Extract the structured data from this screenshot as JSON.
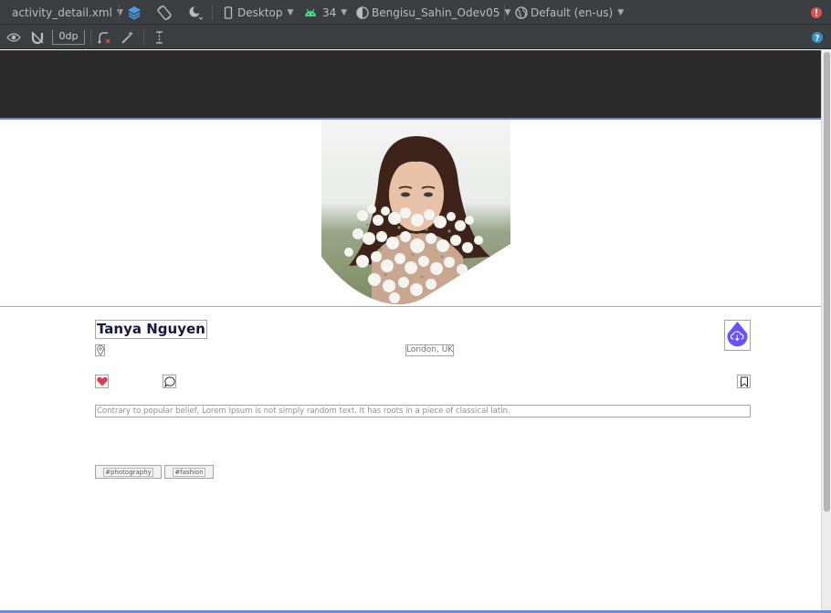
{
  "toolbar": {
    "file_name": "activity_detail.xml",
    "device": "Desktop",
    "api_level": "34",
    "theme": "Bengisu_Sahin_Odev05",
    "locale": "Default (en-us)",
    "margin_value": "0dp"
  },
  "profile": {
    "name": "Tanya Nguyen",
    "location": "London, UK",
    "description": "Contrary to popular belief, Lorem Ipsum is not simply random text. It has roots in a piece of classical latin.",
    "chips": [
      "#photography",
      "#fashion"
    ],
    "accent_color": "#6a52f6",
    "heart_color": "#e23b4e"
  }
}
